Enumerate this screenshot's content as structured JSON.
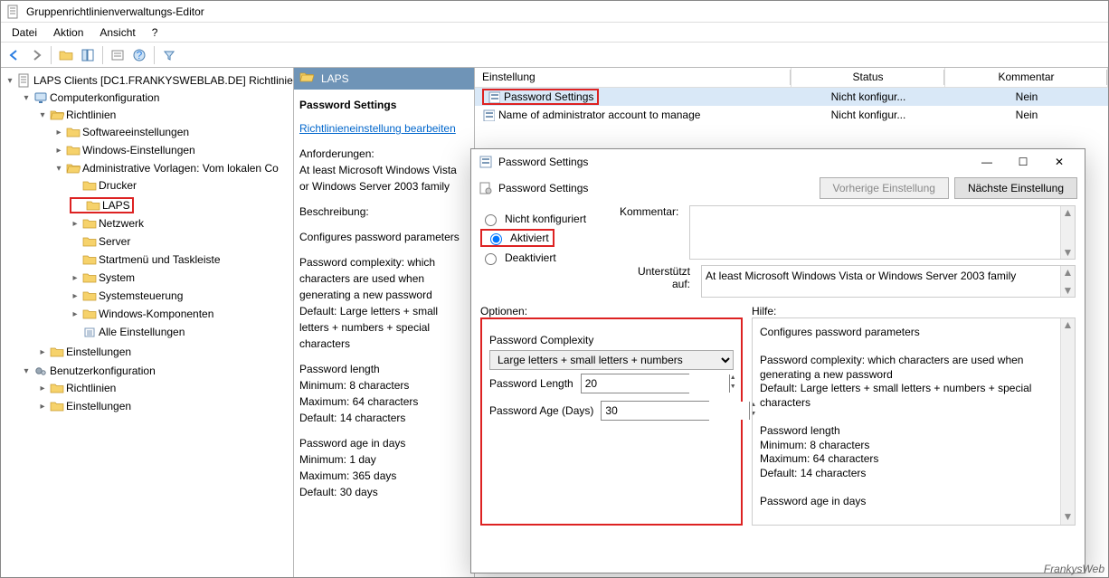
{
  "window": {
    "title": "Gruppenrichtlinienverwaltungs-Editor"
  },
  "menu": {
    "file": "Datei",
    "action": "Aktion",
    "view": "Ansicht",
    "help": "?"
  },
  "tree": {
    "root": "LAPS Clients [DC1.FRANKYSWEBLAB.DE] Richtlinie",
    "comp": "Computerkonfiguration",
    "richt": "Richtlinien",
    "soft": "Softwareeinstellungen",
    "win": "Windows-Einstellungen",
    "admin": "Administrative Vorlagen: Vom lokalen Co",
    "drucker": "Drucker",
    "laps": "LAPS",
    "netz": "Netzwerk",
    "server": "Server",
    "start": "Startmenü und Taskleiste",
    "system": "System",
    "sysst": "Systemsteuerung",
    "winkomp": "Windows-Komponenten",
    "alle": "Alle Einstellungen",
    "einst": "Einstellungen",
    "benutzer": "Benutzerkonfiguration",
    "brich": "Richtlinien",
    "beinst": "Einstellungen"
  },
  "mid": {
    "header": "LAPS",
    "title": "Password Settings",
    "link": "Richtlinieneinstellung bearbeiten",
    "reqH": "Anforderungen:",
    "req": "At least Microsoft Windows Vista or Windows Server 2003 family",
    "descH": "Beschreibung:",
    "l1": "Configures password parameters",
    "l2": "Password complexity: which characters are used when generating a new password",
    "l3": "  Default: Large letters + small letters + numbers + special characters",
    "l4": "Password length",
    "l5": "  Minimum: 8 characters",
    "l6": "  Maximum: 64 characters",
    "l7": "  Default: 14 characters",
    "l8": "Password age in days",
    "l9": "  Minimum: 1 day",
    "l10": "  Maximum: 365 days",
    "l11": "  Default: 30 days"
  },
  "list": {
    "hSetting": "Einstellung",
    "hStatus": "Status",
    "hComment": "Kommentar",
    "r1": {
      "name": "Password Settings",
      "status": "Nicht konfigur...",
      "comment": "Nein"
    },
    "r2": {
      "name": "Name of administrator account to manage",
      "status": "Nicht konfigur...",
      "comment": "Nein"
    }
  },
  "dialog": {
    "title": "Password Settings",
    "sub": "Password Settings",
    "prev": "Vorherige Einstellung",
    "next": "Nächste Einstellung",
    "rNC": "Nicht konfiguriert",
    "rAk": "Aktiviert",
    "rDe": "Deaktiviert",
    "komment": "Kommentar:",
    "supportLbl": "Unterstützt auf:",
    "support": "At least Microsoft Windows Vista or Windows Server 2003 family",
    "optH": "Optionen:",
    "hilfeH": "Hilfe:",
    "complexityLbl": "Password Complexity",
    "complexityVal": "Large letters + small letters + numbers",
    "lenLbl": "Password Length",
    "lenVal": "20",
    "ageLbl": "Password Age (Days)",
    "ageVal": "30",
    "h1": "Configures password parameters",
    "h2": "Password complexity: which characters are used when generating a new password",
    "h3": "  Default: Large letters + small letters + numbers + special characters",
    "h4": "Password length",
    "h5": "  Minimum: 8 characters",
    "h6": "  Maximum: 64 characters",
    "h7": "  Default: 14 characters",
    "h8": "Password age in days"
  },
  "footer": "FrankysWeb"
}
